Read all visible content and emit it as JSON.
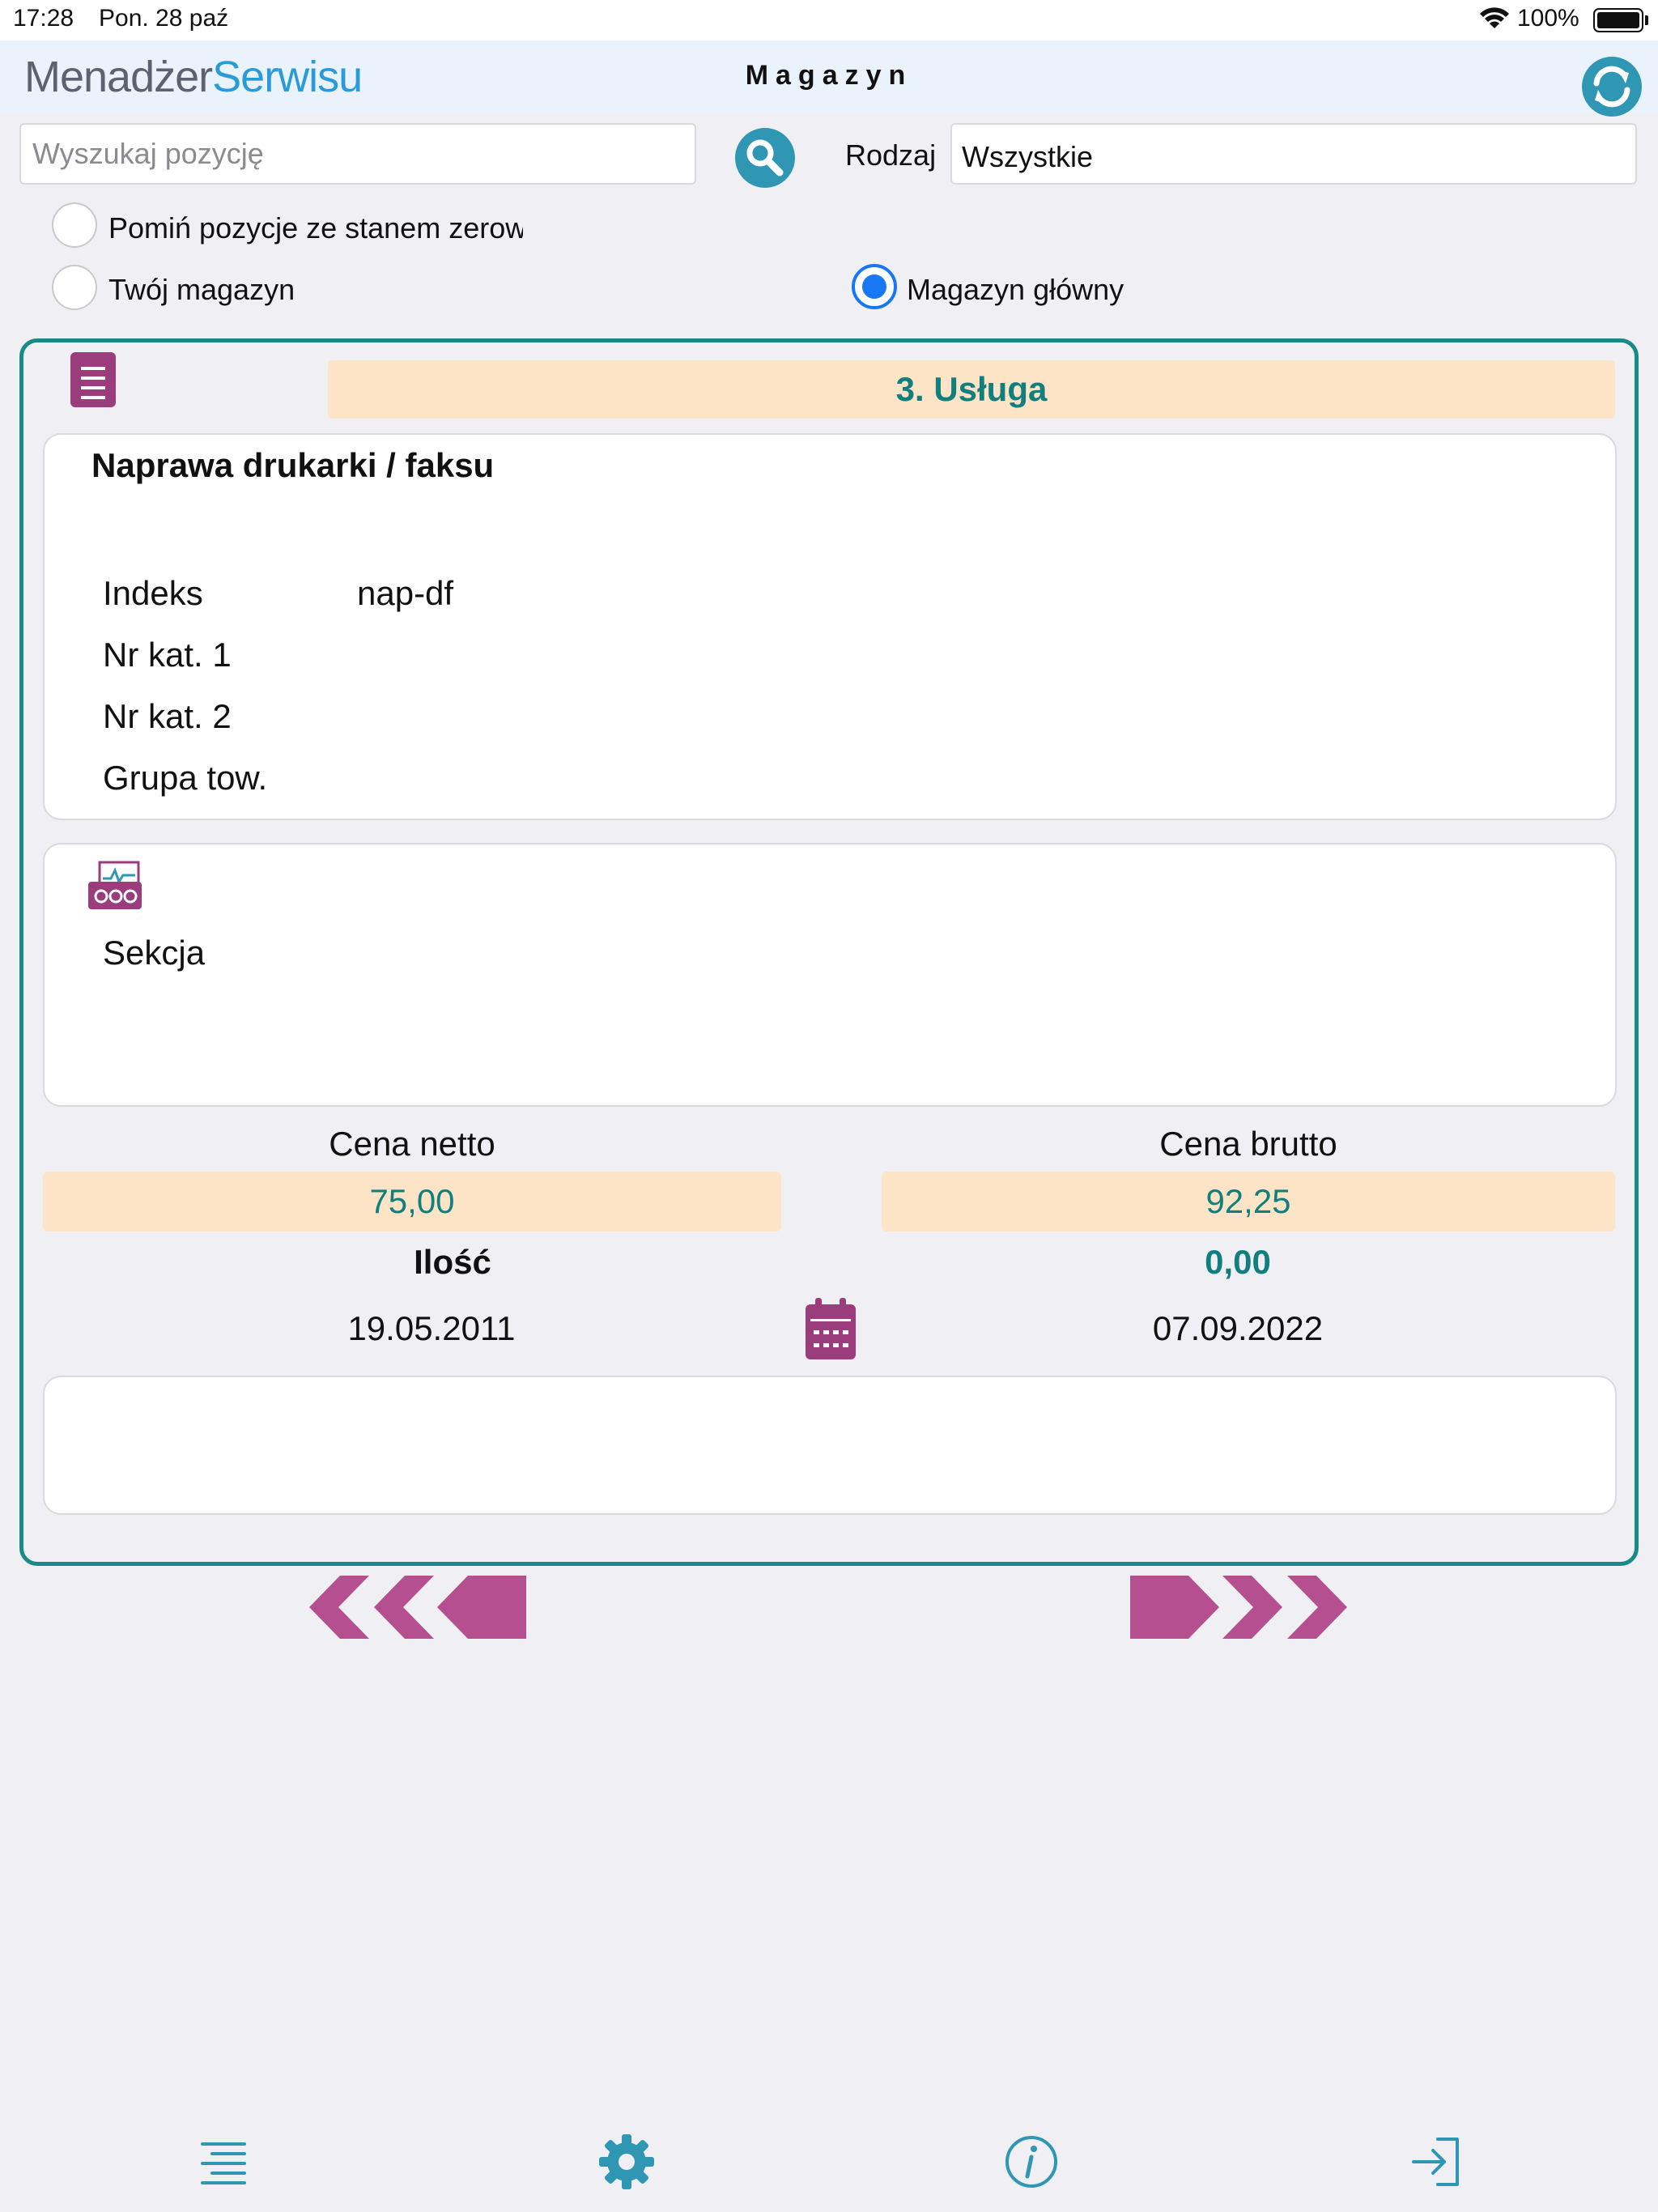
{
  "status_bar": {
    "time": "17:28",
    "date": "Pon. 28 paź",
    "battery": "100%"
  },
  "header": {
    "logo_part1": "Menadżer",
    "logo_part2": "Serwisu",
    "title": "Magazyn"
  },
  "search": {
    "placeholder": "Wyszukaj pozycję",
    "value": ""
  },
  "filter": {
    "label": "Rodzaj",
    "value": "Wszystkie"
  },
  "options": {
    "skip_zero": {
      "label": "Pomiń pozycje ze stanem zerow",
      "selected": false
    },
    "your_warehouse": {
      "label": "Twój magazyn",
      "selected": false
    },
    "main_warehouse": {
      "label": "Magazyn główny",
      "selected": true
    }
  },
  "item": {
    "type": "3. Usługa",
    "name": "Naprawa drukarki / faksu",
    "fields": [
      {
        "label": "Indeks",
        "value": "nap-df"
      },
      {
        "label": "Nr kat. 1",
        "value": ""
      },
      {
        "label": "Nr kat. 2",
        "value": ""
      },
      {
        "label": "Grupa tow.",
        "value": ""
      }
    ],
    "section_label": "Sekcja",
    "net_price_label": "Cena netto",
    "net_price": "75,00",
    "gross_price_label": "Cena brutto",
    "gross_price": "92,25",
    "quantity_label": "Ilość",
    "quantity": "0,00",
    "date_from": "19.05.2011",
    "date_to": "07.09.2022",
    "notes": ""
  },
  "icons": {
    "refresh": "refresh-icon",
    "search": "search-icon",
    "document": "document-icon",
    "section": "section-icon",
    "calendar": "calendar-icon",
    "prev": "double-chevron-left-icon",
    "next": "double-chevron-right-icon",
    "list": "list-icon",
    "settings": "gear-icon",
    "info": "info-icon",
    "logout": "logout-icon"
  },
  "colors": {
    "accent": "#1a8a88",
    "brand_blue": "#2a9ad8",
    "magenta": "#b54f8f",
    "banner": "#fde4c6",
    "radio_on": "#1877f2"
  }
}
